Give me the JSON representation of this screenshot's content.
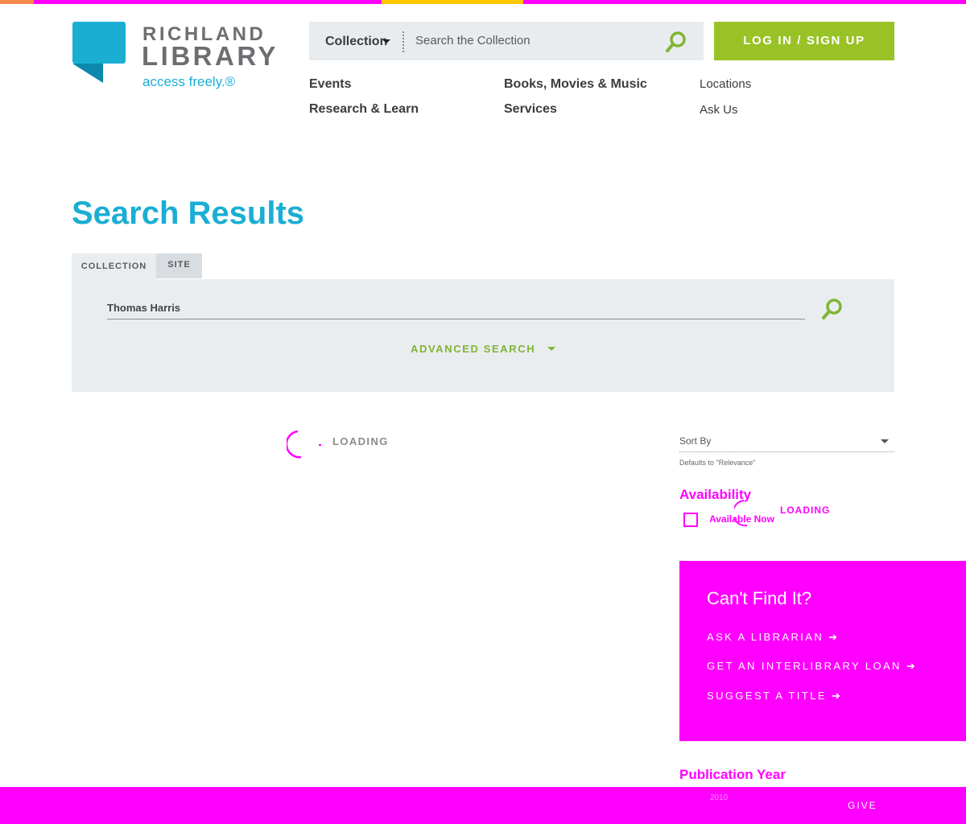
{
  "colors": {
    "brand_blue": "#1aaed3",
    "login_green": "#99c227",
    "advanced_green": "#80b534",
    "magenta": "#ff00ff",
    "panel_grey": "#eaedf0",
    "stripe": [
      "#f58a4b",
      "#ff00ff",
      "#ffc800",
      "#ff00ff"
    ]
  },
  "logo": {
    "line1": "RICHLAND",
    "line2": "LIBRARY",
    "tagline": "access freely.®"
  },
  "header_search": {
    "scope_label": "Collection",
    "placeholder": "Search the Collection",
    "icon": "search-icon"
  },
  "login_label": "LOG IN / SIGN UP",
  "nav": {
    "events": "Events",
    "research": "Research & Learn",
    "books": "Books, Movies & Music",
    "services": "Services",
    "locations": "Locations",
    "ask": "Ask Us"
  },
  "page_title": "Search Results",
  "tabs": {
    "collection": "COLLECTION",
    "site": "SITE"
  },
  "search_panel": {
    "query": "Thomas Harris",
    "advanced": "ADVANCED SEARCH",
    "icon": "search-icon"
  },
  "results": {
    "loading": "LOADING"
  },
  "sort": {
    "label": "Sort By",
    "hint": "Defaults to \"Relevance\""
  },
  "facets": {
    "availability_title": "Availability",
    "available_now": "Available Now",
    "loading": "LOADING",
    "publication_year_title": "Publication Year"
  },
  "cant_find": {
    "title": "Can't Find It?",
    "ask": "ASK A LIBRARIAN ➔",
    "ill": "GET AN INTERLIBRARY LOAN ➔",
    "suggest": "SUGGEST A TITLE ➔"
  },
  "footer": {
    "year_value": "2010",
    "give": "GIVE"
  }
}
